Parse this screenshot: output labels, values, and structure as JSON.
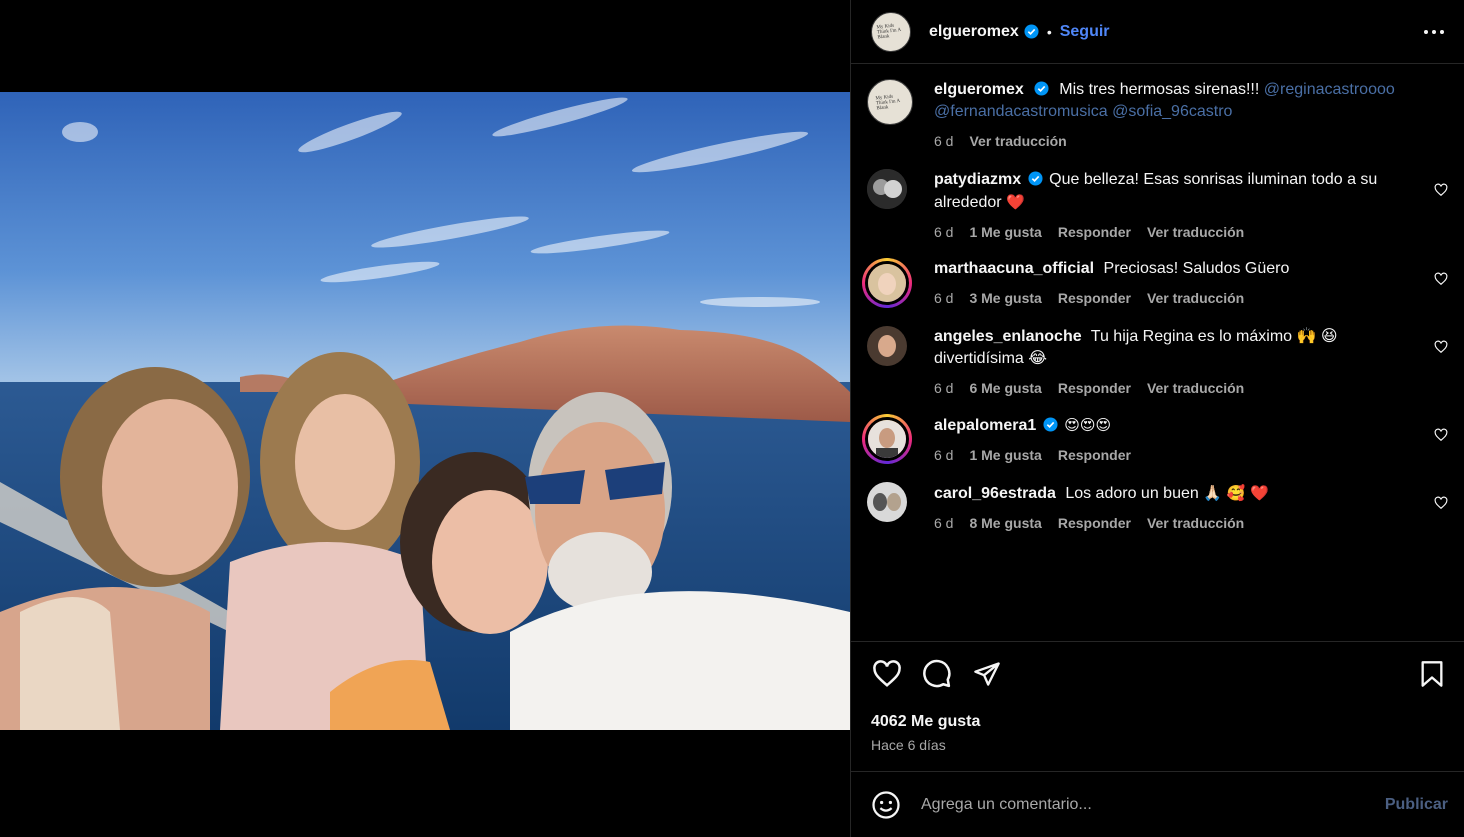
{
  "post": {
    "author": "elgueromex",
    "follow_label": "Seguir",
    "separator": "•",
    "avatar_text": "My Kids Think I'm A Blank"
  },
  "caption": {
    "username": "elgueromex",
    "text": "Mis tres hermosas sirenas!!!",
    "mentions": [
      "@reginacastroooo",
      "@fernandacastromusica",
      "@sofia_96castro"
    ],
    "time": "6 d",
    "translate": "Ver traducción"
  },
  "comments": [
    {
      "username": "patydiazmx",
      "text": "Que belleza! Esas sonrisas iluminan todo a su alrededor",
      "emoji": "❤️",
      "time": "6 d",
      "likes": "1 Me gusta",
      "reply": "Responder",
      "translate": "Ver traducción"
    },
    {
      "username": "marthaacuna_official",
      "text": "Preciosas! Saludos Güero",
      "emoji": "",
      "time": "6 d",
      "likes": "3 Me gusta",
      "reply": "Responder",
      "translate": "Ver traducción"
    },
    {
      "username": "angeles_enlanoche",
      "text": "Tu hija Regina es lo máximo 🙌 😆 divertidísima 😂",
      "emoji": "",
      "time": "6 d",
      "likes": "6 Me gusta",
      "reply": "Responder",
      "translate": "Ver traducción"
    },
    {
      "username": "alepalomera1",
      "text": "😍😍😍",
      "emoji": "",
      "time": "6 d",
      "likes": "1 Me gusta",
      "reply": "Responder",
      "translate": ""
    },
    {
      "username": "carol_96estrada",
      "text": "Los adoro un buen",
      "emoji": "🙏🏻 🥰 ❤️",
      "time": "6 d",
      "likes": "8 Me gusta",
      "reply": "Responder",
      "translate": "Ver traducción"
    }
  ],
  "footer": {
    "likes": "4062 Me gusta",
    "when": "Hace 6 días",
    "comment_placeholder": "Agrega un comentario...",
    "publish_label": "Publicar"
  },
  "icons": {
    "verified": "verified-badge-icon",
    "more": "more-options-icon",
    "like": "heart-icon",
    "comment": "comment-icon",
    "share": "share-icon",
    "save": "bookmark-icon",
    "emoji": "emoji-icon"
  },
  "colors": {
    "background": "#000000",
    "link": "#4f86f7",
    "mention": "#4a6fa5",
    "muted": "#a8a8a8",
    "verified": "#0095f6",
    "publish": "#4b5f82"
  }
}
